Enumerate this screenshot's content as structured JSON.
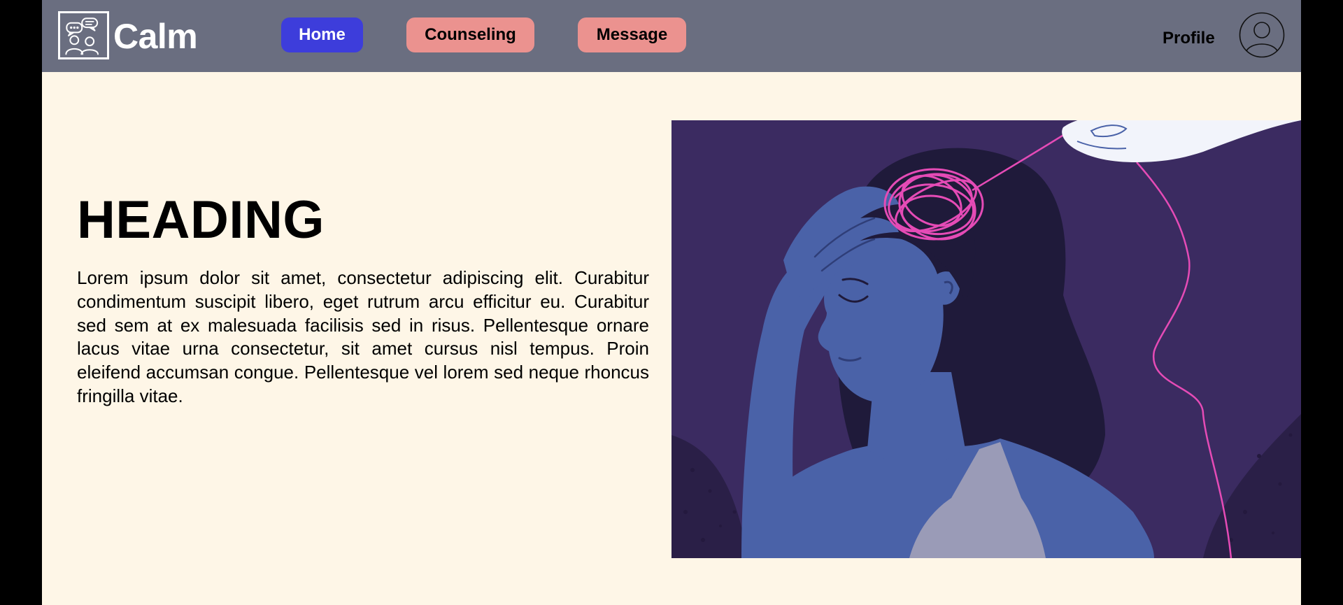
{
  "app": {
    "brand": "Calm",
    "logo_icon": "counseling-chat-icon"
  },
  "nav": {
    "items": [
      {
        "label": "Home",
        "active": true
      },
      {
        "label": "Counseling",
        "active": false
      },
      {
        "label": "Message",
        "active": false
      }
    ],
    "profile_label": "Profile",
    "profile_icon": "user-avatar-icon"
  },
  "hero": {
    "heading": "HEADING",
    "body": "Lorem ipsum dolor sit amet, consectetur adipiscing elit. Curabitur condimentum suscipit libero, eget rutrum arcu efficitur eu. Curabitur sed sem at ex malesuada facilisis sed in risus. Pellentesque ornare lacus vitae urna consectetur, sit amet cursus nisl tempus. Proin eleifend accumsan congue. Pellentesque vel lorem sed neque rhoncus fringilla vitae."
  },
  "colors": {
    "navbar": "#6a6e80",
    "page_background": "#fef6e7",
    "active_button": "#3d3ddb",
    "inactive_button": "#eb928f",
    "illustration_background": "#3b2b61",
    "tangle": "#e54bb6"
  }
}
